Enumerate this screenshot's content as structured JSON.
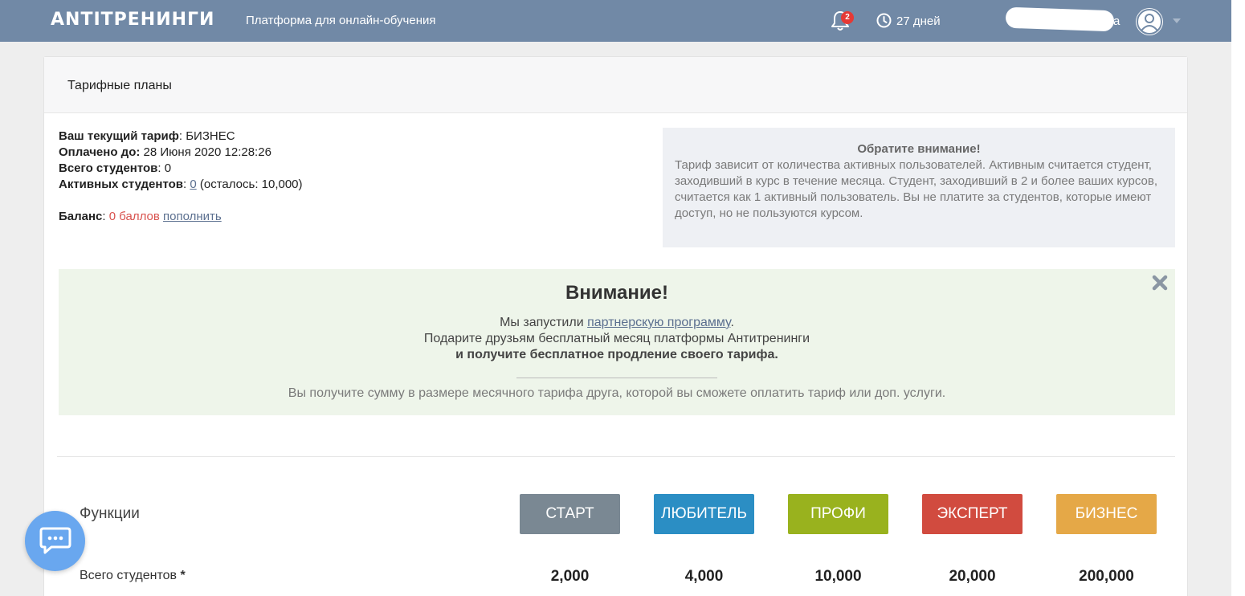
{
  "topbar": {
    "logo": "ANTITPEHИНГИ",
    "subtitle": "Платформа для онлайн-обучения",
    "notification_count": "2",
    "days_left": "27 дней",
    "username_tail": "а"
  },
  "card": {
    "title": "Тарифные планы"
  },
  "account": {
    "tariff_label": "Ваш текущий тариф",
    "tariff_value": ": БИЗНЕС",
    "paid_label": "Оплачено до:",
    "paid_value": " 28 Июня 2020 12:28:26",
    "students_label": "Всего студентов",
    "students_value": ": 0",
    "active_label": "Активных студентов",
    "active_sep": ": ",
    "active_value": "0",
    "active_left": " (осталось: 10,000)",
    "balance_label": "Баланс",
    "balance_sep": ": ",
    "balance_value": "0 баллов",
    "topup_link": "пополнить"
  },
  "note": {
    "title": "Обратите внимание!",
    "text": "Тариф зависит от количества активных пользователей. Активным считается студент, заходивший в курс в течение месяца. Студент, заходивший в 2 и более ваших курсов, считается как 1 активный пользователь. Вы не платите за студентов, которые имеют доступ, но не пользуются курсом."
  },
  "alert": {
    "title": "Внимание!",
    "line1_pre": "Мы запустили ",
    "line1_link": "партнерскую программу",
    "line1_post": ".",
    "line2": "Подарите друзьям бесплатный месяц платформы Антитренинги",
    "line3": "и получите бесплатное продление своего тарифа.",
    "line4": "Вы получите сумму в размере месячного тарифа друга, которой вы сможете оплатить тариф или доп. услуги."
  },
  "plans": {
    "functions_label": "Функции",
    "items": [
      {
        "label": "СТАРТ",
        "color": "#7a8893",
        "students": "2,000"
      },
      {
        "label": "ЛЮБИТЕЛЬ",
        "color": "#2b8ec4",
        "students": "4,000"
      },
      {
        "label": "ПРОФИ",
        "color": "#99b21e",
        "students": "10,000"
      },
      {
        "label": "ЭКСПЕРТ",
        "color": "#d14b3f",
        "students": "20,000"
      },
      {
        "label": "БИЗНЕС",
        "color": "#e5a847",
        "students": "200,000"
      }
    ],
    "students_row_label": "Всего студентов ",
    "students_row_star": "*"
  },
  "colors": {
    "topbar": "#7189a6",
    "balance_red": "#d9534f",
    "chat_button": "#69a7ef"
  },
  "icons": [
    "bell-icon",
    "clock-icon",
    "avatar-icon",
    "chevron-down-icon",
    "close-icon",
    "chat-icon"
  ]
}
